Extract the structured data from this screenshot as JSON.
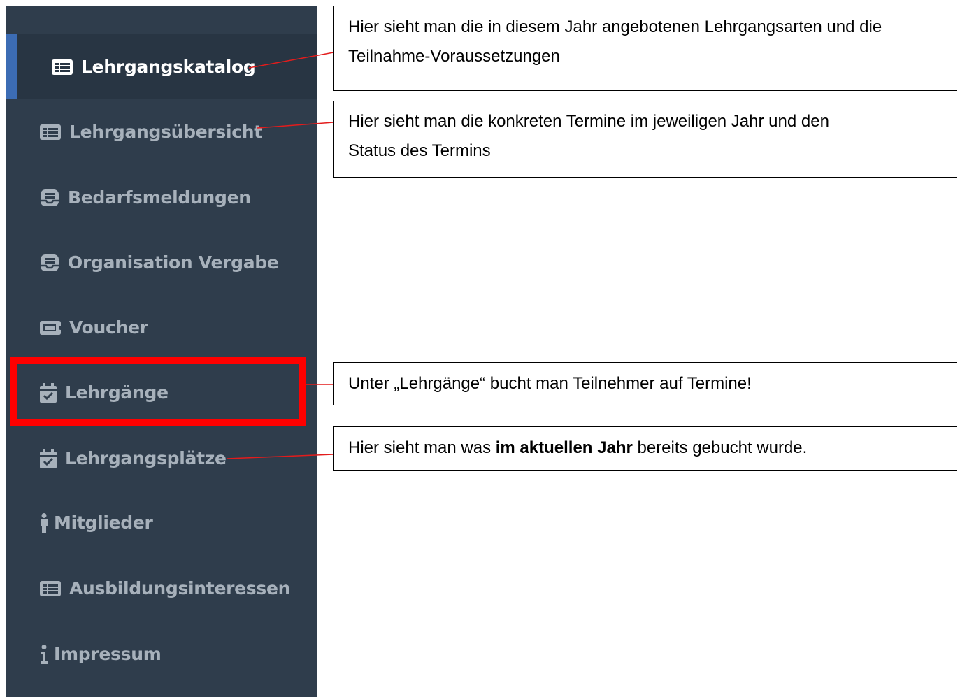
{
  "sidebar": {
    "items": [
      {
        "label": "Lehrgangskatalog",
        "icon": "list-card-icon",
        "active": true
      },
      {
        "label": "Lehrgangsübersicht",
        "icon": "list-card-icon"
      },
      {
        "label": "Bedarfsmeldungen",
        "icon": "inbox-icon"
      },
      {
        "label": "Organisation Vergabe",
        "icon": "inbox-icon"
      },
      {
        "label": "Voucher",
        "icon": "ticket-icon"
      },
      {
        "label": "Lehrgänge",
        "icon": "calendar-check-icon",
        "highlighted": true
      },
      {
        "label": "Lehrgangsplätze",
        "icon": "calendar-check-icon"
      },
      {
        "label": "Mitglieder",
        "icon": "person-icon"
      },
      {
        "label": "Ausbildungsinteressen",
        "icon": "list-card-icon"
      },
      {
        "label": "Impressum",
        "icon": "info-icon"
      }
    ]
  },
  "callouts": {
    "catalog": {
      "line1": "Hier sieht man die in diesem Jahr angebotenen Lehrgangsarten und die",
      "line2": "Teilnahme-Voraussetzungen"
    },
    "overview": {
      "line1": "Hier sieht man die konkreten Termine im jeweiligen Jahr und den",
      "line2": "Status des Termins"
    },
    "courses": {
      "text": "Unter „Lehrgänge“ bucht man Teilnehmer auf Termine!"
    },
    "places": {
      "text_before": "Hier sieht man was ",
      "text_bold": "im aktuellen Jahr",
      "text_after": " bereits gebucht wurde."
    }
  },
  "colors": {
    "sidebar_bg": "#2f3d4c",
    "active_bg": "#283543",
    "active_accent": "#3c6cb4",
    "inactive_text": "#a7b1bb",
    "highlight": "#ff0000",
    "connector": "#e31c1c"
  }
}
